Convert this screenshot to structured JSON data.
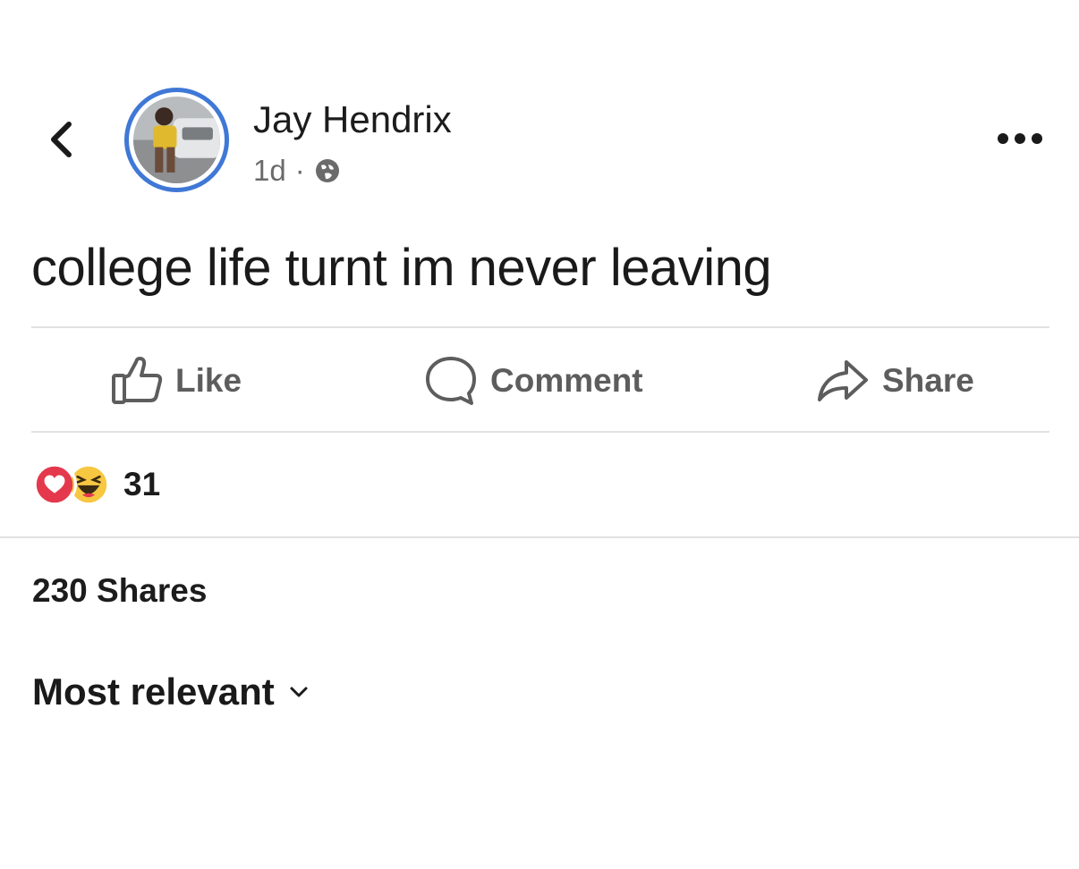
{
  "post": {
    "author_name": "Jay Hendrix",
    "timestamp": "1d",
    "meta_separator": "·",
    "privacy_icon": "globe-icon",
    "text": "college life turnt im never leaving"
  },
  "actions": {
    "like_label": "Like",
    "comment_label": "Comment",
    "share_label": "Share"
  },
  "reactions": {
    "icons": [
      "love-reaction-icon",
      "haha-reaction-icon"
    ],
    "count": "31"
  },
  "shares": {
    "label": "230 Shares"
  },
  "comments": {
    "sort_label": "Most relevant"
  },
  "colors": {
    "avatar_ring": "#3f78d6",
    "love_red": "#e4384d",
    "haha_yellow": "#f7c742",
    "action_gray": "#5d5d5d"
  }
}
